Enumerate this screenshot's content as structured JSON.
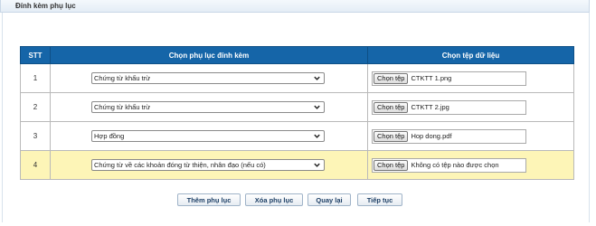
{
  "panel": {
    "title": "Đính kèm phụ lục"
  },
  "table": {
    "headers": {
      "stt": "STT",
      "attachment": "Chọn phụ lục đính kèm",
      "file": "Chọn tệp dữ liệu"
    },
    "rows": [
      {
        "stt": "1",
        "attachment": "Chứng từ khấu trừ",
        "file_button": "Chọn tệp",
        "file_name": "CTKTT 1.png"
      },
      {
        "stt": "2",
        "attachment": "Chứng từ khấu trừ",
        "file_button": "Chọn tệp",
        "file_name": "CTKTT 2.jpg"
      },
      {
        "stt": "3",
        "attachment": "Hợp đồng",
        "file_button": "Chọn tệp",
        "file_name": "Hop dong.pdf"
      },
      {
        "stt": "4",
        "attachment": "Chứng từ về các khoản đóng từ thiện, nhân đạo (nếu có)",
        "file_button": "Chọn tệp",
        "file_name": "Không có tệp nào được chọn"
      }
    ]
  },
  "actions": {
    "add": "Thêm phụ lục",
    "remove": "Xóa phụ lục",
    "back": "Quay lại",
    "next": "Tiếp tục"
  },
  "colors": {
    "header_bg": "#1565a8",
    "highlight_row": "#fdf5b7"
  }
}
